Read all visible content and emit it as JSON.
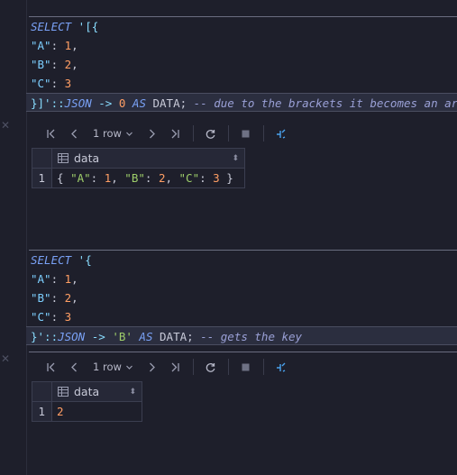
{
  "query1": {
    "lines": [
      [
        "SELECT",
        " '[{"
      ],
      [
        "\"A\"",
        ": ",
        "1",
        ","
      ],
      [
        "\"B\"",
        ": ",
        "2",
        ","
      ],
      [
        "\"C\"",
        ": ",
        "3"
      ],
      [
        "}]'::",
        "JSON",
        " -> ",
        "0",
        " AS ",
        "DATA",
        "; ",
        "-- due to the brackets it becomes an array"
      ]
    ]
  },
  "result1": {
    "rows_label": "1 row",
    "column": "data",
    "rows": [
      {
        "num": "1",
        "value_parts": [
          "{ ",
          "\"A\"",
          ": ",
          "1",
          ", ",
          "\"B\"",
          ": ",
          "2",
          ", ",
          "\"C\"",
          ": ",
          "3",
          " }"
        ]
      }
    ]
  },
  "query2": {
    "lines": [
      [
        "SELECT",
        " '{"
      ],
      [
        "\"A\"",
        ": ",
        "1",
        ","
      ],
      [
        "\"B\"",
        ": ",
        "2",
        ","
      ],
      [
        "\"C\"",
        ": ",
        "3"
      ],
      [
        "}'::",
        "JSON",
        " -> ",
        "'B'",
        " AS ",
        "DATA",
        "; ",
        "-- gets the key"
      ]
    ]
  },
  "result2": {
    "rows_label": "1 row",
    "column": "data",
    "rows": [
      {
        "num": "1",
        "value": "2"
      }
    ]
  },
  "icons": [
    "first-page-icon",
    "prev-page-icon",
    "chevron-down-icon",
    "next-page-icon",
    "last-page-icon",
    "refresh-icon",
    "stop-icon",
    "pin-settings-icon",
    "table-icon",
    "sort-icon",
    "close-icon"
  ],
  "colors": {
    "background": "#1e1f2b",
    "keyword": "#7aa2f7",
    "string": "#9ece6a",
    "number": "#ff9e64",
    "comment": "#9aa0d6"
  }
}
